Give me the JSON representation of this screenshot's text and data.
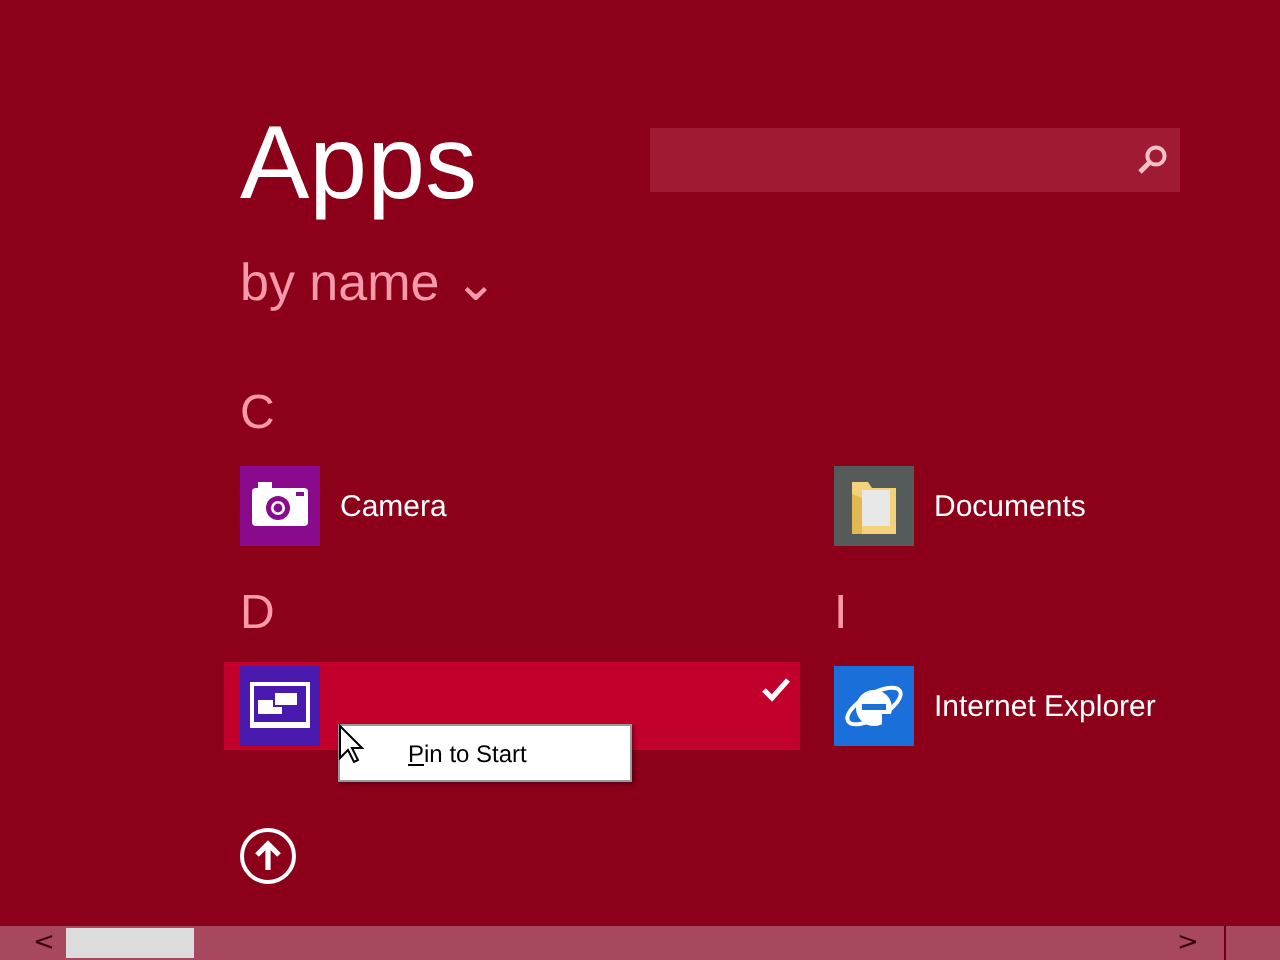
{
  "title": "Apps",
  "sort": {
    "label": "by name",
    "caret": "⌄"
  },
  "groups": [
    {
      "letter": "C",
      "apps": [
        {
          "name": "Camera",
          "kind": "camera",
          "selected": false
        }
      ]
    },
    {
      "letter": "D",
      "apps": [
        {
          "kind": "desktop",
          "selected": true
        }
      ]
    },
    {
      "apps": [
        {
          "name": "Documents",
          "kind": "folder",
          "selected": false
        }
      ]
    },
    {
      "letter": "I",
      "apps": [
        {
          "name": "Internet Explorer",
          "kind": "ie",
          "selected": false
        }
      ]
    }
  ],
  "context_menu": {
    "items": [
      "Pin to Start"
    ]
  },
  "scrollbar": {
    "left": "<",
    "right": ">"
  }
}
